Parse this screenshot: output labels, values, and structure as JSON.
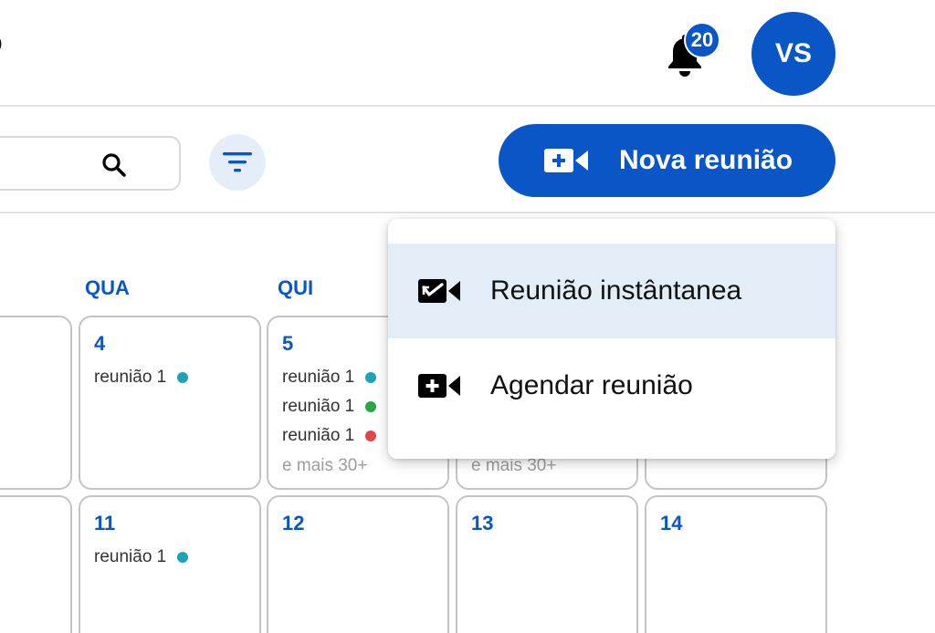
{
  "header": {
    "title_fragment": "o",
    "notifications_count": "20",
    "avatar_initials": "VS"
  },
  "toolbar": {
    "search_placeholder": "",
    "new_meeting_label": "Nova reunião"
  },
  "calendar": {
    "weekdays": [
      {
        "label": "QUA"
      },
      {
        "label": "QUI"
      }
    ],
    "cells": [
      {
        "day": "4",
        "events": [
          {
            "label": "reunião 1",
            "color": "#1ba3b8"
          }
        ],
        "more": ""
      },
      {
        "day": "5",
        "events": [
          {
            "label": "reunião 1",
            "color": "#1ba3b8"
          },
          {
            "label": "reunião 1",
            "color": "#27a844"
          },
          {
            "label": "reunião 1",
            "color": "#e0464a"
          }
        ],
        "more": "e mais 30+"
      },
      {
        "day": "",
        "events": [],
        "more": "e mais 30+"
      },
      {
        "day": "11",
        "events": [
          {
            "label": "reunião 1",
            "color": "#1ba3b8"
          }
        ],
        "more": ""
      },
      {
        "day": "12",
        "events": [],
        "more": ""
      },
      {
        "day": "13",
        "events": [],
        "more": ""
      },
      {
        "day": "14",
        "events": [],
        "more": ""
      }
    ]
  },
  "dropdown": {
    "items": [
      {
        "label": "Reunião instântanea",
        "icon": "video-check-icon",
        "active": true
      },
      {
        "label": "Agendar reunião",
        "icon": "video-add-icon",
        "active": false
      }
    ]
  },
  "colors": {
    "primary": "#0a56c7",
    "menu_highlight": "#e3edf8",
    "filter_bg": "#e4edf8"
  }
}
